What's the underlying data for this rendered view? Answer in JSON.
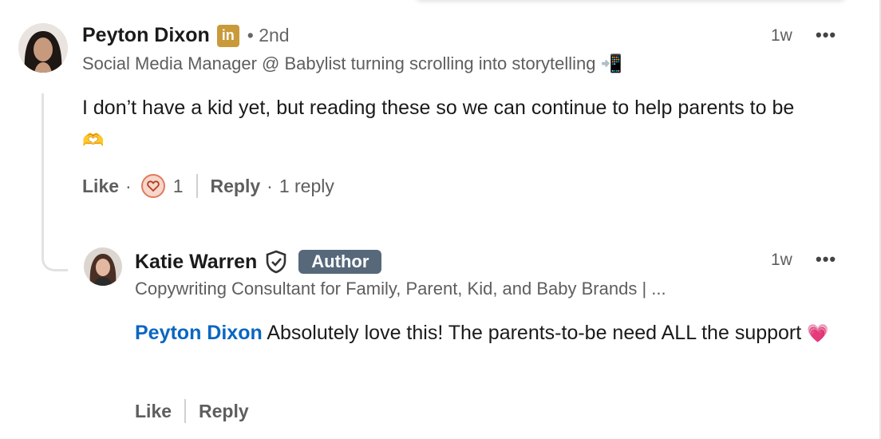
{
  "comment": {
    "author": "Peyton Dixon",
    "badge": "in",
    "degree": "• 2nd",
    "headline": "Social Media Manager @ Babylist turning scrolling into storytelling",
    "headline_emoji": "📲",
    "time": "1w",
    "more": "•••",
    "text": "I don’t have a kid yet, but reading these so we can continue to help parents to be",
    "text_emoji": "🫶",
    "like_label": "Like",
    "reaction_count": "1",
    "reply_label": "Reply",
    "reply_count": "1 reply"
  },
  "reply": {
    "author": "Katie Warren",
    "author_badge": "Author",
    "headline": "Copywriting Consultant for Family, Parent, Kid, and Baby Brands | ...",
    "time": "1w",
    "more": "•••",
    "mention": "Peyton Dixon",
    "text": "Absolutely love this! The parents-to-be need ALL the support",
    "text_emoji": "💗",
    "like_label": "Like",
    "reply_label": "Reply"
  },
  "colors": {
    "mention": "#0a66c2",
    "author_badge_bg": "#56687a",
    "linkedin_badge_bg": "#c99a3a",
    "reaction_heart": "#e07a5f"
  }
}
